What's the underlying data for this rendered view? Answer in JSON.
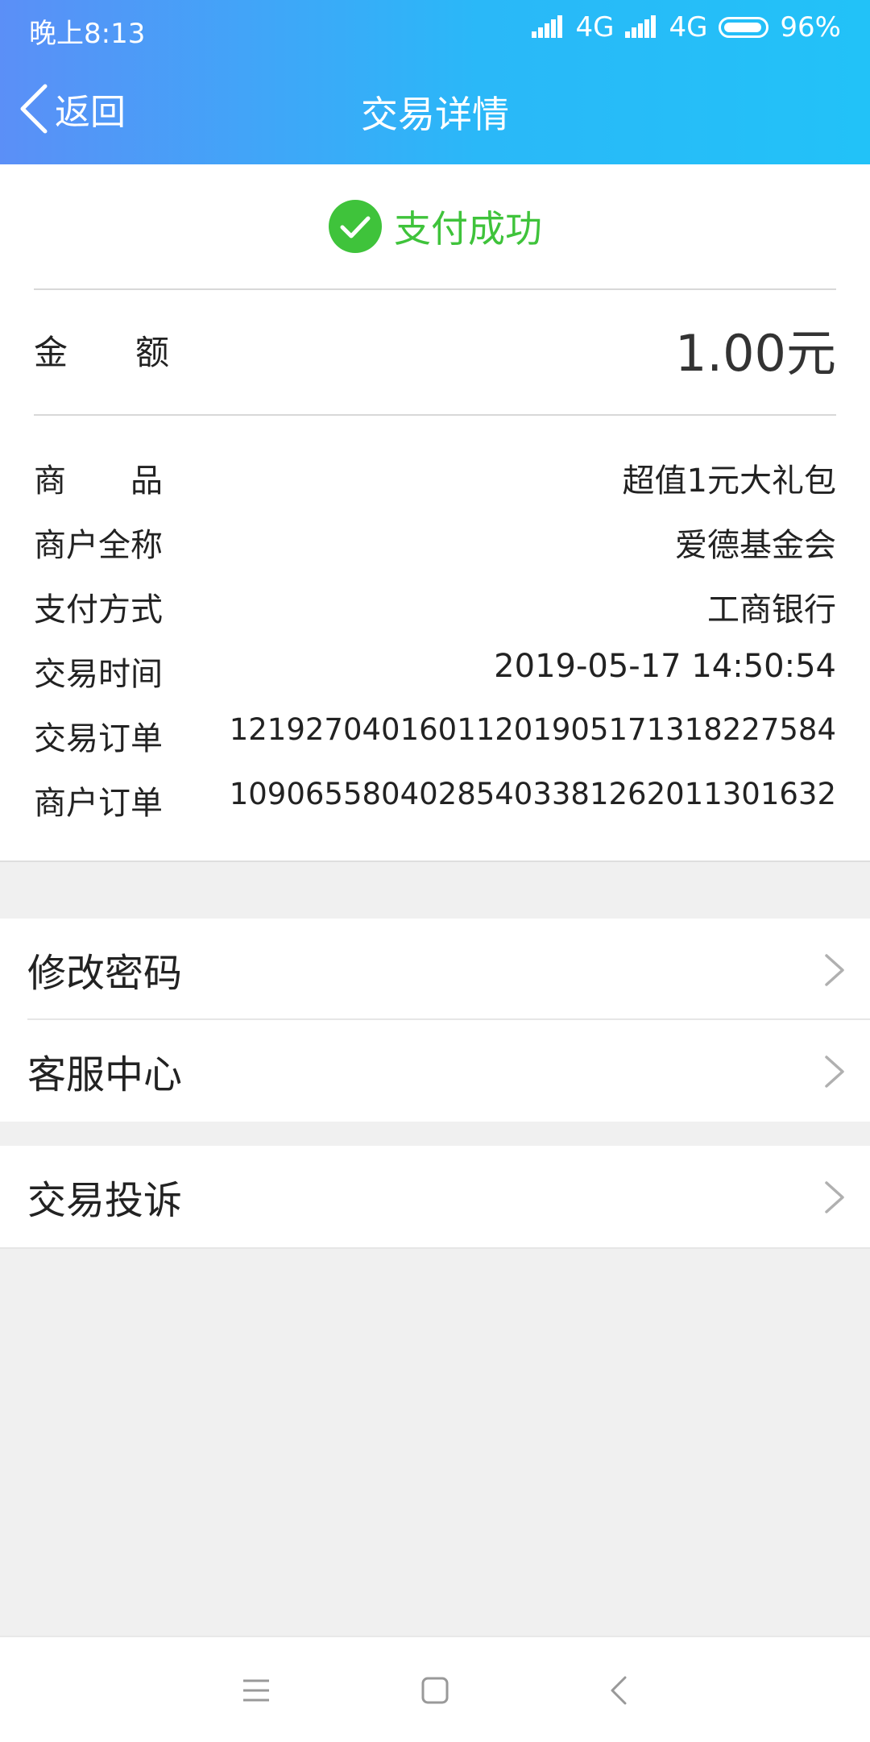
{
  "status_bar": {
    "time": "晚上8:13",
    "network1": "4G",
    "network2": "4G",
    "battery": "96%"
  },
  "nav": {
    "back_label": "返回",
    "title": "交易详情"
  },
  "payment": {
    "status": "支付成功",
    "status_color": "#3fc33b",
    "amount_label": "金　　额",
    "amount_value": "1.00元"
  },
  "details": [
    {
      "label": "商　　品",
      "value": "超值1元大礼包"
    },
    {
      "label": "商户全称",
      "value": "爱德基金会"
    },
    {
      "label": "支付方式",
      "value": "工商银行"
    },
    {
      "label": "交易时间",
      "value": "2019-05-17 14:50:54"
    },
    {
      "label": "交易订单",
      "value": "1219270401601120190517131822758​4"
    },
    {
      "label": "商户订单",
      "value": "1090655804028540338126201130163​2"
    }
  ],
  "menu_group_1": [
    {
      "label": "修改密码"
    },
    {
      "label": "客服中心"
    }
  ],
  "menu_group_2": [
    {
      "label": "交易投诉"
    }
  ],
  "colors": {
    "header_start": "#5b8ff7",
    "header_end": "#22c2f8",
    "success": "#3fc33b"
  }
}
